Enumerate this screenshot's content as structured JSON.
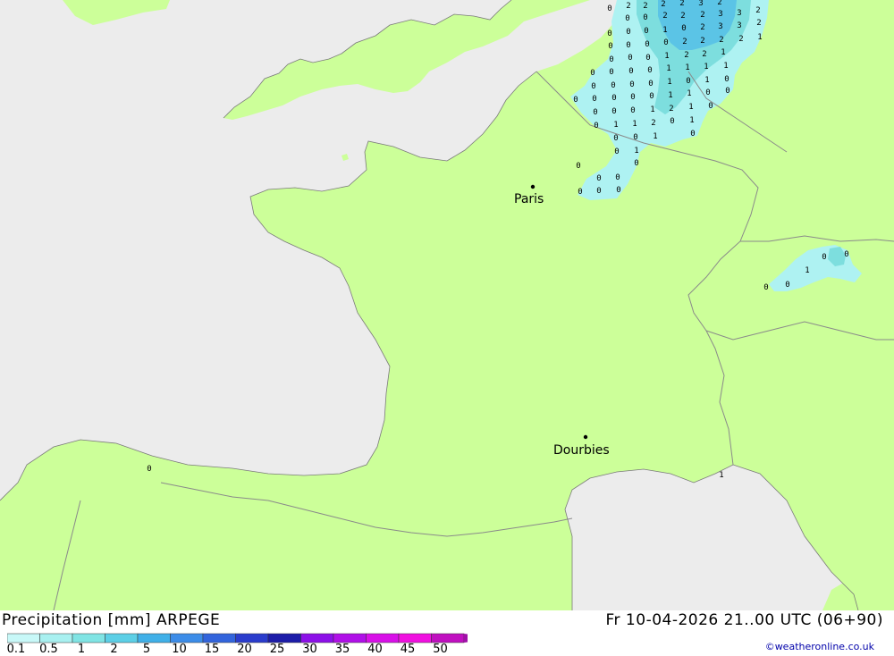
{
  "map": {
    "cities": [
      {
        "name": "Paris"
      },
      {
        "name": "Dourbies"
      }
    ],
    "colors": {
      "sea": "#ececec",
      "land": "#ccff99",
      "rain_light": "#aef2f2",
      "rain_med": "#7ddede",
      "rain_heavy": "#5bc4e6",
      "border": "#8a8a8a",
      "coast": "#7a7a7a"
    },
    "precip_values": [
      "0",
      "2",
      "2",
      "2",
      "2",
      "3",
      "2",
      "0",
      "0",
      "2",
      "2",
      "2",
      "3",
      "3",
      "2",
      "0",
      "0",
      "0",
      "1",
      "0",
      "2",
      "3",
      "3",
      "2",
      "0",
      "0",
      "0",
      "0",
      "2",
      "2",
      "2",
      "2",
      "1",
      "0",
      "0",
      "0",
      "1",
      "2",
      "2",
      "1",
      "0",
      "0",
      "0",
      "0",
      "1",
      "1",
      "1",
      "1",
      "0",
      "0",
      "0",
      "0",
      "1",
      "0",
      "1",
      "0",
      "0",
      "0",
      "0",
      "0",
      "0",
      "1",
      "1",
      "0",
      "0",
      "0",
      "0",
      "0",
      "1",
      "2",
      "1",
      "0",
      "0",
      "1",
      "1",
      "2",
      "0",
      "1",
      "0",
      "0",
      "1",
      "0",
      "0",
      "1",
      "0",
      "0",
      "0",
      "0",
      "0",
      "0",
      "0",
      "0",
      "0",
      "1",
      "0",
      "0",
      "0",
      "1",
      "0",
      "0",
      "0",
      "0",
      "0",
      "0",
      "1",
      "0",
      "0",
      "0",
      "0",
      "0",
      "0",
      "0"
    ]
  },
  "footer": {
    "title_left": "Precipitation [mm] ARPEGE",
    "title_right": "Fr 10-04-2026 21..00 UTC (06+90)",
    "credit": "©weatheronline.co.uk",
    "scale_labels": [
      "0.1",
      "0.5",
      "1",
      "2",
      "5",
      "10",
      "15",
      "20",
      "25",
      "30",
      "35",
      "40",
      "45",
      "50"
    ],
    "scale_colors": [
      "#c8f8f8",
      "#a8f0f0",
      "#80e4e4",
      "#5ccfe6",
      "#40b0e8",
      "#3c8ce8",
      "#3264dc",
      "#2a3ccc",
      "#1c1ca8",
      "#8c10e8",
      "#b010e8",
      "#d810e8",
      "#f010e0",
      "#c010c0",
      "#a010a8"
    ]
  }
}
